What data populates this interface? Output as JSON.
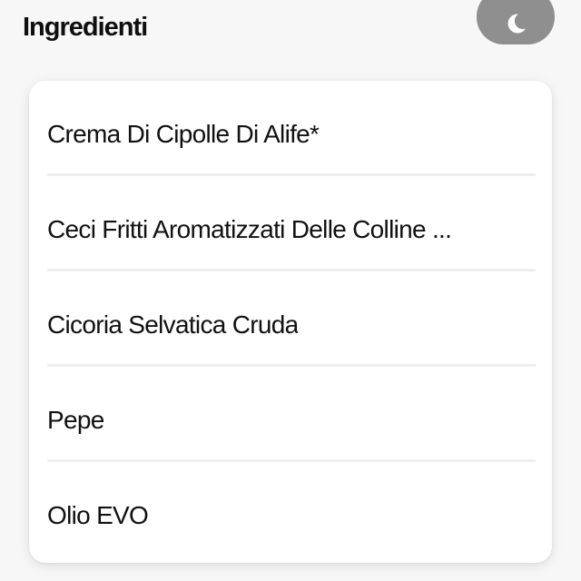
{
  "header": {
    "title": "Ingredienti",
    "theme_toggle_icon": "moon-icon",
    "theme_toggle_color": "#8f8f8f"
  },
  "ingredients": {
    "items": [
      {
        "label": "Crema Di Cipolle Di Alife*"
      },
      {
        "label": "Ceci Fritti Aromatizzati Delle Colline ..."
      },
      {
        "label": "Cicoria Selvatica Cruda"
      },
      {
        "label": "Pepe"
      },
      {
        "label": "Olio EVO"
      }
    ]
  }
}
